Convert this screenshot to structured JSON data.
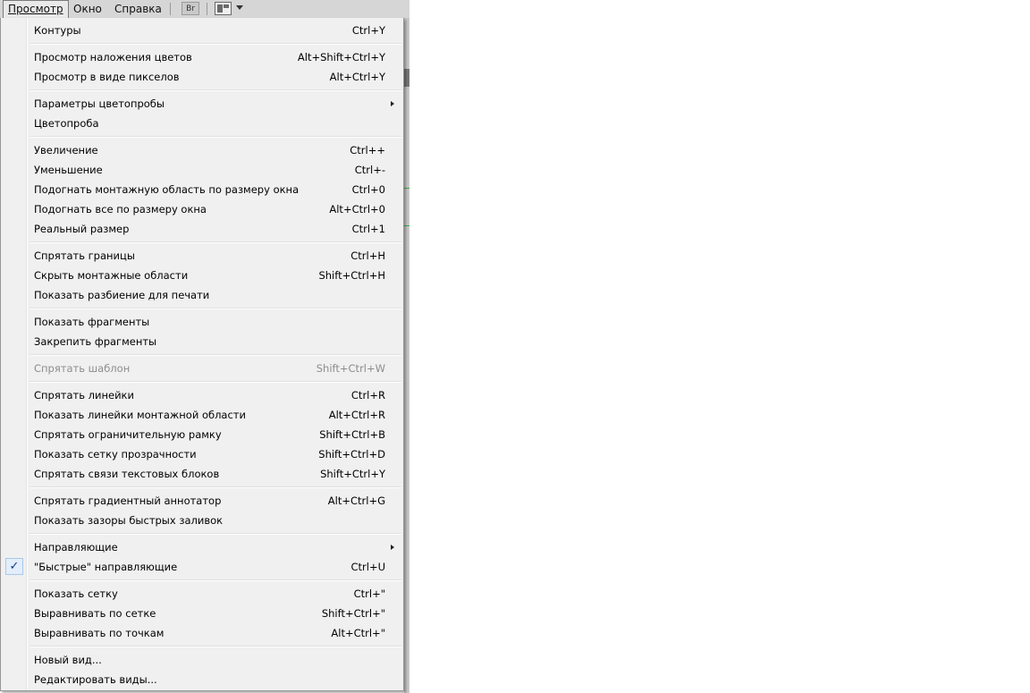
{
  "menubar": {
    "items": [
      "Просмотр",
      "Окно",
      "Справка"
    ],
    "bridge_label": "Br"
  },
  "menu": {
    "groups": [
      [
        {
          "label": "Контуры",
          "shortcut": "Ctrl+Y"
        }
      ],
      [
        {
          "label": "Просмотр наложения цветов",
          "shortcut": "Alt+Shift+Ctrl+Y"
        },
        {
          "label": "Просмотр в виде пикселов",
          "shortcut": "Alt+Ctrl+Y"
        }
      ],
      [
        {
          "label": "Параметры цветопробы",
          "shortcut": "",
          "submenu": true
        },
        {
          "label": "Цветопроба",
          "shortcut": ""
        }
      ],
      [
        {
          "label": "Увеличение",
          "shortcut": "Ctrl++"
        },
        {
          "label": "Уменьшение",
          "shortcut": "Ctrl+-"
        },
        {
          "label": "Подогнать монтажную область по размеру окна",
          "shortcut": "Ctrl+0"
        },
        {
          "label": "Подогнать все по размеру окна",
          "shortcut": "Alt+Ctrl+0"
        },
        {
          "label": "Реальный размер",
          "shortcut": "Ctrl+1"
        }
      ],
      [
        {
          "label": "Спрятать границы",
          "shortcut": "Ctrl+H"
        },
        {
          "label": "Скрыть монтажные области",
          "shortcut": "Shift+Ctrl+H"
        },
        {
          "label": "Показать разбиение для печати",
          "shortcut": ""
        }
      ],
      [
        {
          "label": "Показать фрагменты",
          "shortcut": ""
        },
        {
          "label": "Закрепить фрагменты",
          "shortcut": ""
        }
      ],
      [
        {
          "label": "Спрятать шаблон",
          "shortcut": "Shift+Ctrl+W",
          "disabled": true
        }
      ],
      [
        {
          "label": "Спрятать линейки",
          "shortcut": "Ctrl+R"
        },
        {
          "label": "Показать линейки монтажной области",
          "shortcut": "Alt+Ctrl+R"
        },
        {
          "label": "Спрятать ограничительную рамку",
          "shortcut": "Shift+Ctrl+B"
        },
        {
          "label": "Показать сетку прозрачности",
          "shortcut": "Shift+Ctrl+D"
        },
        {
          "label": "Спрятать связи текстовых блоков",
          "shortcut": "Shift+Ctrl+Y"
        }
      ],
      [
        {
          "label": "Спрятать градиентный аннотатор",
          "shortcut": "Alt+Ctrl+G"
        },
        {
          "label": "Показать зазоры быстрых заливок",
          "shortcut": ""
        }
      ],
      [
        {
          "label": "Направляющие",
          "shortcut": "",
          "submenu": true
        },
        {
          "label": "\"Быстрые\" направляющие",
          "shortcut": "Ctrl+U",
          "checked": true
        }
      ],
      [
        {
          "label": "Показать сетку",
          "shortcut": "Ctrl+\""
        },
        {
          "label": "Выравнивать по сетке",
          "shortcut": "Shift+Ctrl+\""
        },
        {
          "label": "Выравнивать по точкам",
          "shortcut": "Alt+Ctrl+\""
        }
      ],
      [
        {
          "label": "Новый вид...",
          "shortcut": ""
        },
        {
          "label": "Редактировать виды...",
          "shortcut": ""
        }
      ]
    ]
  }
}
